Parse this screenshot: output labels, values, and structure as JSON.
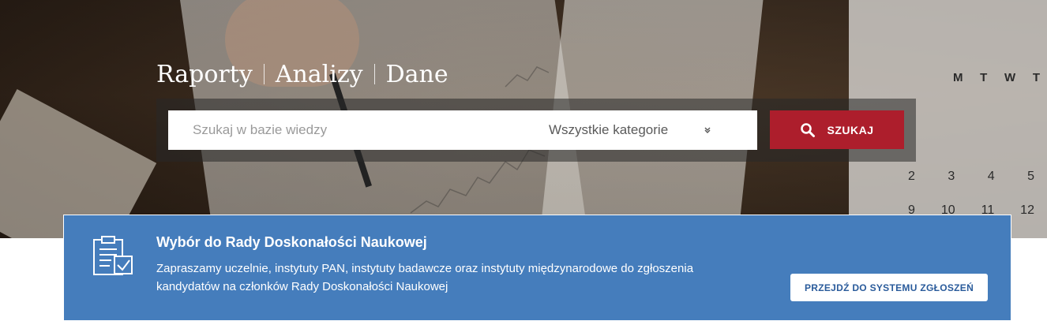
{
  "hero": {
    "taglines": [
      "Raporty",
      "Analizy",
      "Dane"
    ],
    "calendar": {
      "weekdays": [
        "M",
        "T",
        "W",
        "T"
      ],
      "row1": [
        "2",
        "3",
        "4",
        "5"
      ],
      "row2": [
        "9",
        "10",
        "11",
        "12"
      ]
    }
  },
  "search": {
    "placeholder": "Szukaj w bazie wiedzy",
    "category": "Wszystkie kategorie",
    "button_label": "SZUKAJ"
  },
  "banner": {
    "title": "Wybór do Rady Doskonałości Naukowej",
    "text": "Zapraszamy uczelnie, instytuty PAN, instytuty badawcze oraz instytuty międzynarodowe do zgłoszenia kandydatów na członków Rady Doskonałości Naukowej",
    "button_label": "PRZEJDŹ DO SYSTEMU ZGŁOSZEŃ"
  },
  "colors": {
    "banner_bg": "#457dbc",
    "search_button": "#ad1e2c"
  }
}
